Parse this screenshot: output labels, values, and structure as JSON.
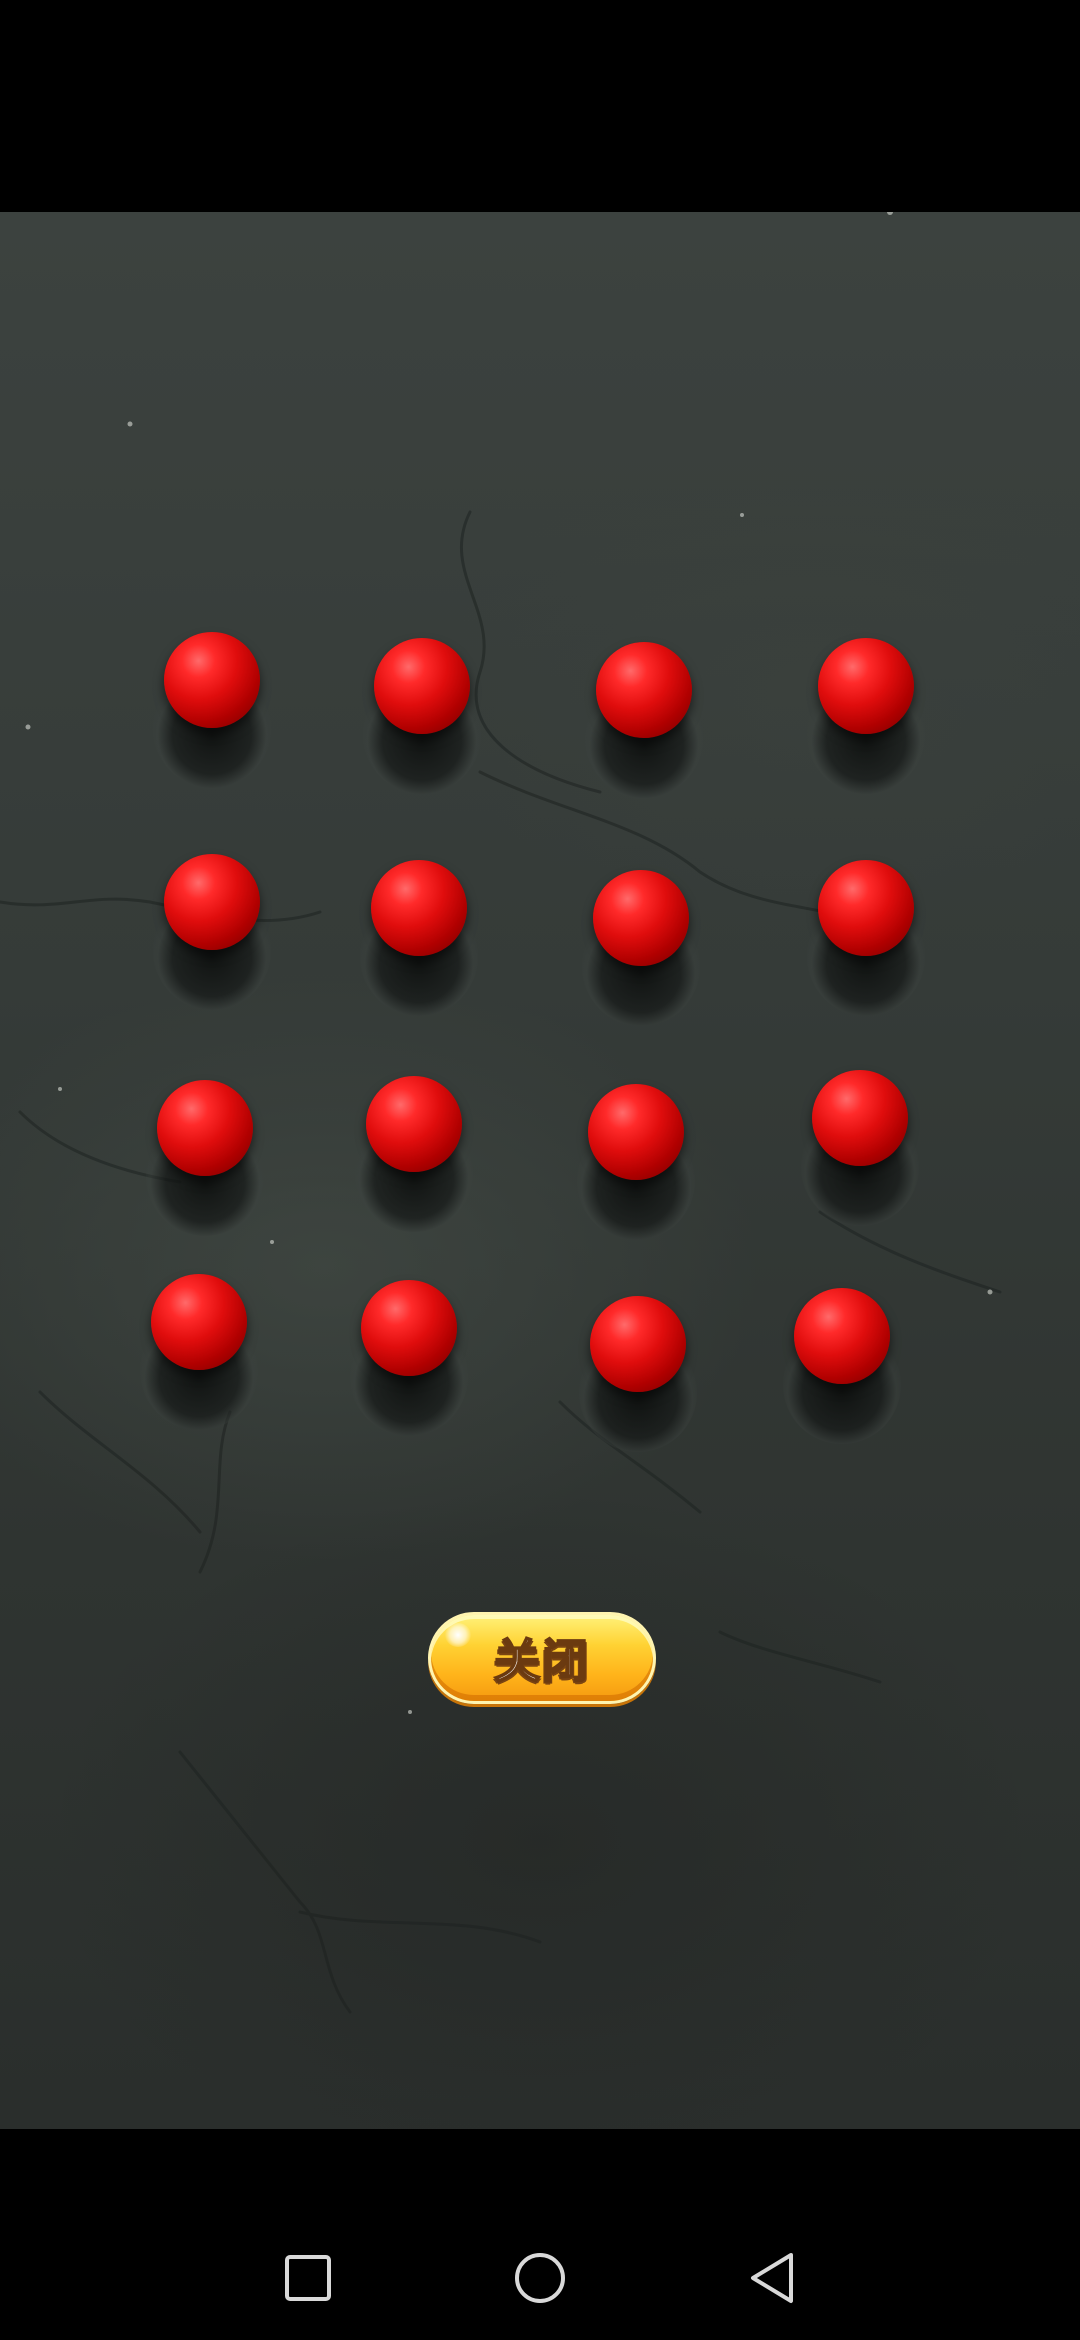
{
  "screen": {
    "background": "#000000",
    "table_color": "#353b38"
  },
  "board": {
    "rows": 4,
    "columns": 4,
    "ball_color": "#e00d0d",
    "ball_count": 16
  },
  "close_button": {
    "label": "关闭",
    "color": "#ffc426"
  },
  "navigation": {
    "recents_icon": "square-icon",
    "home_icon": "circle-icon",
    "back_icon": "triangle-back-icon"
  }
}
